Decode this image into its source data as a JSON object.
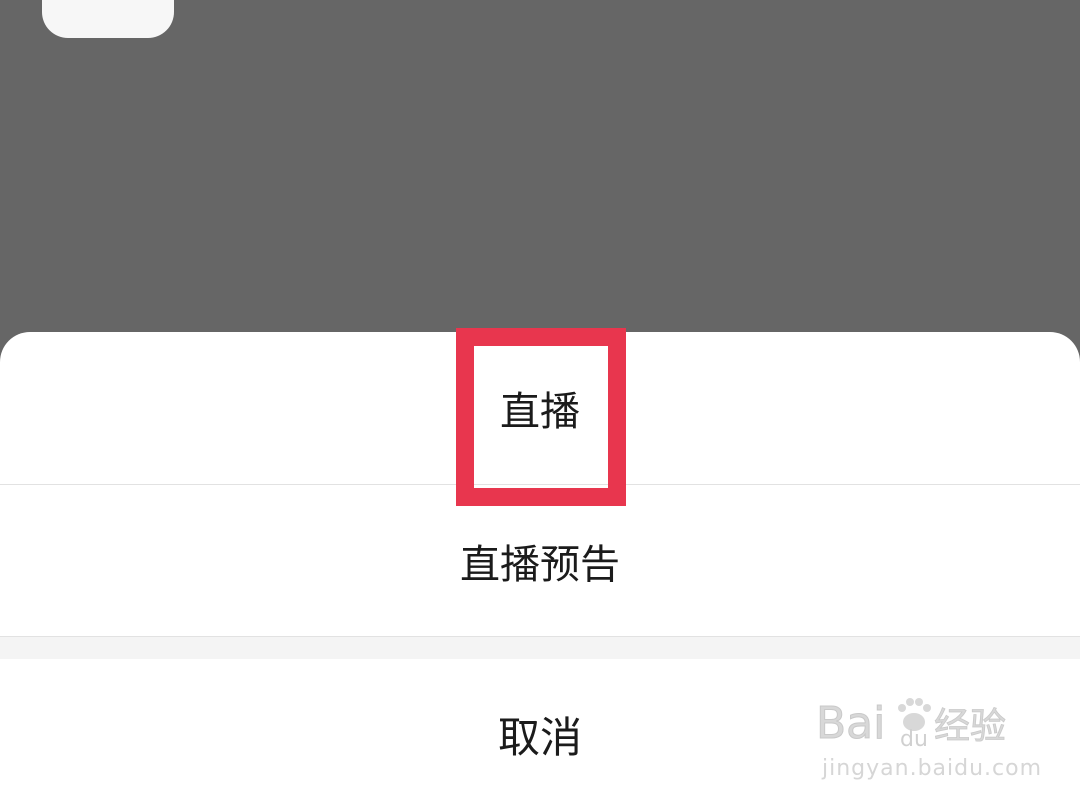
{
  "action_sheet": {
    "options": [
      {
        "label": "直播"
      },
      {
        "label": "直播预告"
      }
    ],
    "cancel_label": "取消"
  },
  "annotation": {
    "highlight_color": "#e8364e",
    "highlighted_option": "直播"
  },
  "watermark": {
    "brand": "Baidu经验",
    "url": "jingyan.baidu.com"
  },
  "colors": {
    "backdrop": "#666666",
    "sheet": "#ffffff",
    "text": "#1b1b1b"
  }
}
